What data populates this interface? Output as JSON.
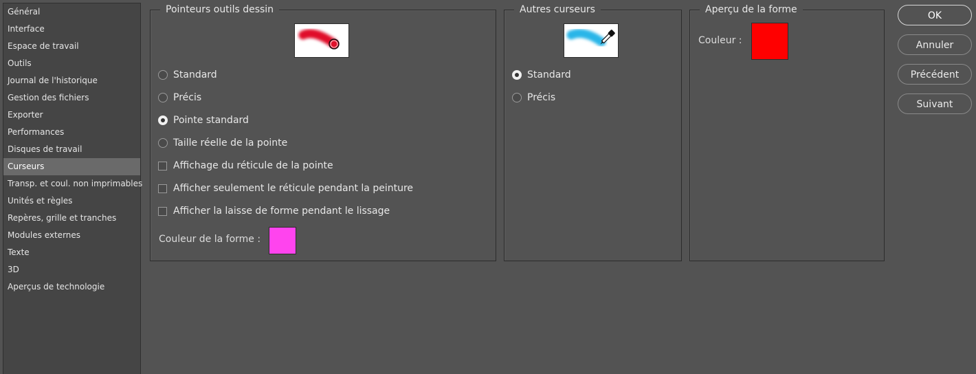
{
  "sidebar": {
    "items": [
      {
        "label": "Général"
      },
      {
        "label": "Interface"
      },
      {
        "label": "Espace de travail"
      },
      {
        "label": "Outils"
      },
      {
        "label": "Journal de l'historique"
      },
      {
        "label": "Gestion des fichiers"
      },
      {
        "label": "Exporter"
      },
      {
        "label": "Performances"
      },
      {
        "label": "Disques de travail"
      },
      {
        "label": "Curseurs"
      },
      {
        "label": "Transp. et coul. non imprimables"
      },
      {
        "label": "Unités et règles"
      },
      {
        "label": "Repères, grille et tranches"
      },
      {
        "label": "Modules externes"
      },
      {
        "label": "Texte"
      },
      {
        "label": "3D"
      },
      {
        "label": "Aperçus de technologie"
      }
    ],
    "selected": "Curseurs"
  },
  "painting": {
    "title": "Pointeurs outils dessin",
    "options": [
      {
        "label": "Standard",
        "checked": false
      },
      {
        "label": "Précis",
        "checked": false
      },
      {
        "label": "Pointe standard",
        "checked": true
      },
      {
        "label": "Taille réelle de la pointe",
        "checked": false
      }
    ],
    "checkboxes": [
      {
        "label": "Affichage du réticule de la pointe",
        "checked": false
      },
      {
        "label": "Afficher seulement le réticule pendant la peinture",
        "checked": false
      },
      {
        "label": "Afficher la laisse de forme pendant le lissage",
        "checked": false
      }
    ],
    "shape_color_label": "Couleur de la forme :",
    "shape_color": "#ff44ee",
    "preview_color": "#e0102a"
  },
  "other": {
    "title": "Autres curseurs",
    "options": [
      {
        "label": "Standard",
        "checked": true
      },
      {
        "label": "Précis",
        "checked": false
      }
    ],
    "preview_color": "#29b6e8"
  },
  "shape_preview": {
    "title": "Aperçu de la forme",
    "color_label": "Couleur :",
    "color": "#ff0000"
  },
  "buttons": {
    "ok": "OK",
    "cancel": "Annuler",
    "previous": "Précédent",
    "next": "Suivant"
  }
}
